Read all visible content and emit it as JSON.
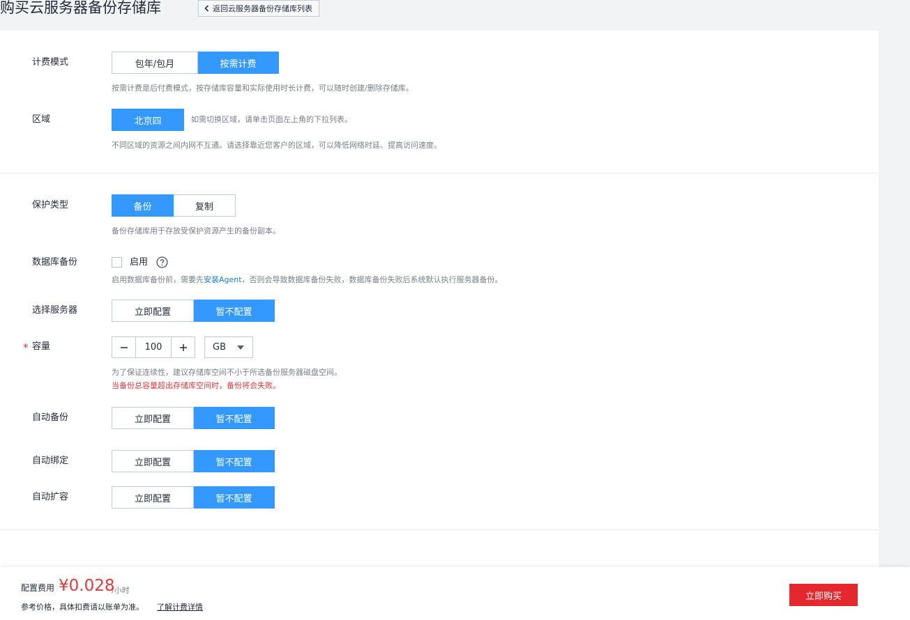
{
  "page": {
    "title": "购买云服务器备份存储库",
    "back_label": "返回云服务器备份存储库列表"
  },
  "billing": {
    "label": "计费模式",
    "options": [
      "包年/包月",
      "按需计费"
    ],
    "selected": "按需计费",
    "hint": "按需计费是后付费模式，按存储库容量和实际使用时长计费，可以随时创建/删除存储库。"
  },
  "region": {
    "label": "区域",
    "value": "北京四",
    "inline_hint": "如需切换区域，请单击页面左上角的下拉列表。",
    "hint": "不同区域的资源之间内网不互通。请选择靠近您客户的区域，可以降低网络时延、提高访问速度。"
  },
  "protection": {
    "label": "保护类型",
    "options": [
      "备份",
      "复制"
    ],
    "selected": "备份",
    "hint": "备份存储库用于存放受保护资源产生的备份副本。"
  },
  "db_backup": {
    "label": "数据库备份",
    "checkbox_label": "启用",
    "checked": false,
    "hint_prefix": "启用数据库备份前，需要先",
    "hint_link": "安装Agent",
    "hint_suffix": "，否则会导致数据库备份失败，数据库备份失败后系统默认执行服务器备份。"
  },
  "server_select": {
    "label": "选择服务器",
    "options": [
      "立即配置",
      "暂不配置"
    ],
    "selected": "暂不配置"
  },
  "capacity": {
    "label": "容量",
    "required_mark": "*",
    "value": "100",
    "unit": "GB",
    "hint": "为了保证连续性，建议存储库空间不小于所选备份服务器磁盘空间。",
    "warning": "当备份总容量超出存储库空间时，备份将会失败。"
  },
  "auto_backup": {
    "label": "自动备份",
    "options": [
      "立即配置",
      "暂不配置"
    ],
    "selected": "暂不配置"
  },
  "auto_bind": {
    "label": "自动绑定",
    "options": [
      "立即配置",
      "暂不配置"
    ],
    "selected": "暂不配置"
  },
  "auto_expand": {
    "label": "自动扩容",
    "options": [
      "立即配置",
      "暂不配置"
    ],
    "selected": "暂不配置"
  },
  "footer": {
    "price_label": "配置费用",
    "price": "¥0.028",
    "price_unit": "/小时",
    "note": "参考价格，具体扣费请以账单为准。",
    "link": "了解计费详情",
    "buy_label": "立即购买"
  },
  "colors": {
    "accent": "#3399ff",
    "buy": "#e4282e",
    "price": "#e4393c",
    "link": "#1f7ae0"
  }
}
